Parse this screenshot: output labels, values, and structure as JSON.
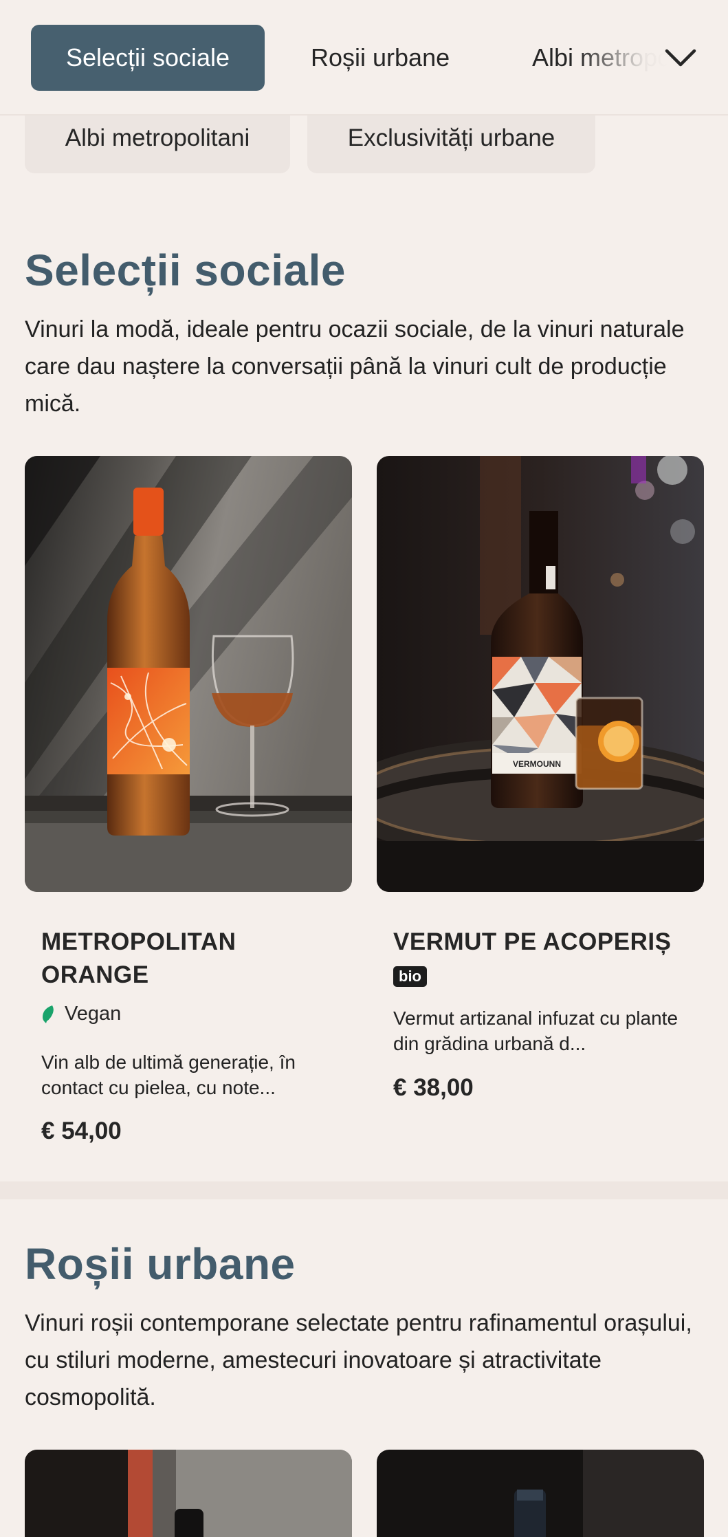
{
  "tabs": {
    "active": "Selecții sociale",
    "second": "Roșii urbane",
    "third": "Albi metropolitani",
    "chevron_icon": "chevron-down-icon"
  },
  "chips": [
    "Albi metropolitani",
    "Exclusivități urbane"
  ],
  "sections": [
    {
      "title": "Selecții sociale",
      "description": "Vinuri la modă, ideale pentru ocazii sociale, de la vinuri naturale care dau naștere la conversații până la vinuri cult de producție mică.",
      "products": [
        {
          "name": "METROPOLITAN ORANGE",
          "tag": "Vegan",
          "tag_icon": "leaf-icon",
          "description": "Vin alb de ultimă generație, în contact cu pielea, cu note...",
          "price": "€ 54,00"
        },
        {
          "name": "VERMUT PE ACOPERIȘ",
          "badge": "bio",
          "description": "Vermut artizanal infuzat cu plante din grădina urbană d...",
          "price": "€ 38,00",
          "label_text": "VERMOUNN"
        }
      ]
    },
    {
      "title": "Roșii urbane",
      "description": "Vinuri roșii contemporane selectate pentru rafinamentul orașului, cu stiluri moderne, amestecuri inovatoare și atractivitate cosmopolită."
    }
  ],
  "colors": {
    "background": "#f5efeb",
    "accent": "#47606f",
    "heading": "#435c6c",
    "vegan_green": "#1aa36b"
  }
}
